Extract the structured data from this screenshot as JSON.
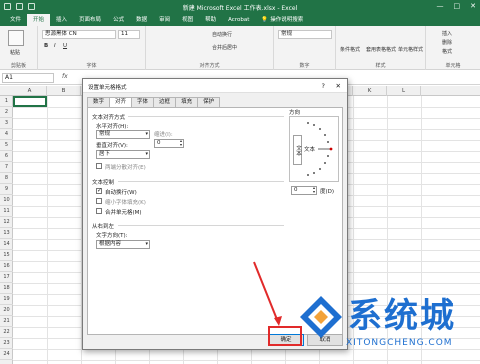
{
  "titlebar": {
    "title": "新建 Microsoft Excel 工作表.xlsx  -  Excel",
    "controls": [
      "—",
      "□",
      "✕"
    ]
  },
  "ribbon_tabs": [
    "文件",
    "开始",
    "插入",
    "页面布局",
    "公式",
    "数据",
    "审阅",
    "视图",
    "帮助",
    "Acrobat",
    "操作说明搜索"
  ],
  "active_tab": "开始",
  "ribbon": {
    "clipboard_label": "粘贴",
    "clipboard_group": "剪贴板",
    "font_name": "思源黑体 CN",
    "font_size": "11",
    "font_group": "字体",
    "bold": "B",
    "italic": "I",
    "underline": "U",
    "wrap_text": "自动换行",
    "merge_center": "合并后居中",
    "align_group": "对齐方式",
    "number_format": "常规",
    "number_group": "数字",
    "cond_format": "条件格式",
    "table_format": "套用表格格式",
    "cell_style": "单元格样式",
    "styles_group": "样式",
    "insert": "插入",
    "delete": "删除",
    "format": "格式",
    "cells_group": "单元格"
  },
  "formula_bar": {
    "name_box": "A1",
    "fx": "fx"
  },
  "grid": {
    "columns": [
      "A",
      "B",
      "C",
      "D",
      "E",
      "F",
      "G",
      "H",
      "I",
      "J",
      "K",
      "L"
    ],
    "rows": [
      "1",
      "2",
      "3",
      "4",
      "5",
      "6",
      "7",
      "8",
      "9",
      "10",
      "11",
      "12",
      "13",
      "14",
      "15",
      "16",
      "17",
      "18",
      "19",
      "20",
      "21",
      "22",
      "23",
      "24"
    ]
  },
  "dialog": {
    "title": "设置单元格格式",
    "help": "?",
    "close": "✕",
    "tabs": [
      "数字",
      "对齐",
      "字体",
      "边框",
      "填充",
      "保护"
    ],
    "active_tab": "对齐",
    "text_align_section": "文本对齐方式",
    "horizontal_label": "水平对齐(H):",
    "horizontal_value": "常规",
    "indent_label": "缩进(I):",
    "indent_value": "0",
    "vertical_label": "垂直对齐(V):",
    "vertical_value": "居下",
    "distributed_label": "两端分散对齐(E)",
    "text_control_section": "文本控制",
    "wrap_label": "自动换行(W)",
    "wrap_checked": true,
    "shrink_label": "缩小字体填充(K)",
    "merge_label": "合并单元格(M)",
    "rtl_section": "从右到左",
    "direction_label": "文字方向(T):",
    "direction_value": "根据内容",
    "orientation_label": "方向",
    "orientation_vertical_text": "文本",
    "orientation_text": "文本",
    "degrees_value": "0",
    "degrees_label": "度(D)",
    "ok": "确定",
    "cancel": "取消"
  },
  "watermark": {
    "brand": "系统城",
    "url": "XITONGCHENG.COM"
  },
  "colors": {
    "excel_green": "#217346",
    "highlight_red": "#e12a2a",
    "watermark_blue": "#1e6fd0"
  }
}
